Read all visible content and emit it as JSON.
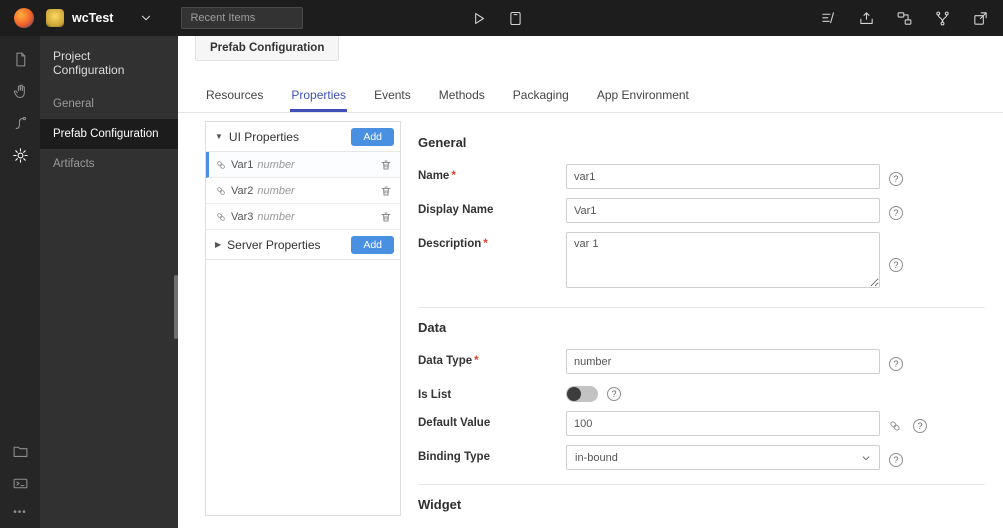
{
  "topbar": {
    "project": "wcTest",
    "recent_placeholder": "Recent Items"
  },
  "nav": {
    "header": "Project Configuration",
    "items": [
      {
        "label": "General"
      },
      {
        "label": "Prefab Configuration"
      },
      {
        "label": "Artifacts"
      }
    ]
  },
  "page_tab": "Prefab Configuration",
  "tabs": [
    {
      "label": "Resources"
    },
    {
      "label": "Properties"
    },
    {
      "label": "Events"
    },
    {
      "label": "Methods"
    },
    {
      "label": "Packaging"
    },
    {
      "label": "App Environment"
    }
  ],
  "panel": {
    "ui_group": {
      "label": "UI Properties",
      "add": "Add"
    },
    "items": [
      {
        "name": "Var1",
        "type": "number"
      },
      {
        "name": "Var2",
        "type": "number"
      },
      {
        "name": "Var3",
        "type": "number"
      }
    ],
    "server_group": {
      "label": "Server Properties",
      "add": "Add"
    }
  },
  "form": {
    "general": {
      "title": "General",
      "name": {
        "label": "Name",
        "value": "var1"
      },
      "display_name": {
        "label": "Display Name",
        "value": "Var1"
      },
      "description": {
        "label": "Description",
        "value": "var 1"
      }
    },
    "data": {
      "title": "Data",
      "data_type": {
        "label": "Data Type",
        "value": "number"
      },
      "is_list": {
        "label": "Is List",
        "on": false
      },
      "default_value": {
        "label": "Default Value",
        "value": "100"
      },
      "binding_type": {
        "label": "Binding Type",
        "value": "in-bound"
      }
    },
    "widget": {
      "title": "Widget"
    }
  },
  "ui": {
    "required_marker": "*",
    "icons": {
      "collapse": "▼",
      "expand": "▶",
      "help": "?",
      "more": "•••"
    },
    "colors": {
      "accent": "#4a90e2",
      "tab_active": "#3f51b5",
      "required": "#e0442c",
      "topbar_bg": "#1d1d1d",
      "rail_bg": "#262626",
      "sidenav_bg": "#313131"
    }
  }
}
